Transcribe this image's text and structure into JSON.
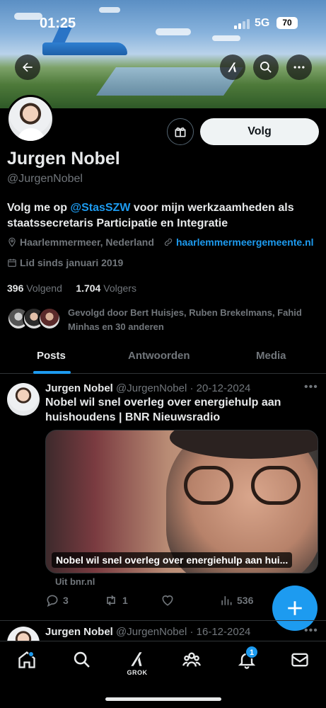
{
  "status_bar": {
    "time": "01:25",
    "network": "5G",
    "battery": "70"
  },
  "profile": {
    "name": "Jurgen Nobel",
    "handle": "@JurgenNobel",
    "follow_label": "Volg",
    "bio_prefix": "Volg me op ",
    "bio_mention": "@StasSZW",
    "bio_suffix": " voor mijn werkzaamheden als staatssecretaris Participatie en Integratie",
    "location": "Haarlemmermeer, Nederland",
    "website": "haarlemmermeergemeente.nl",
    "joined": "Lid sinds januari 2019",
    "following_count": "396",
    "following_label": "Volgend",
    "followers_count": "1.704",
    "followers_label": "Volgers",
    "followed_by": "Gevolgd door Bert Huisjes, Ruben Brekelmans, Fahid Minhas en 30 anderen"
  },
  "tabs": [
    {
      "label": "Posts",
      "active": true
    },
    {
      "label": "Antwoorden",
      "active": false
    },
    {
      "label": "Media",
      "active": false
    }
  ],
  "posts": [
    {
      "author": "Jurgen Nobel",
      "handle": "@JurgenNobel",
      "date": "· 20-12-2024",
      "text": "Nobel wil snel overleg over energiehulp aan huishoudens | BNR Nieuwsradio",
      "card_title": "Nobel wil snel overleg over energiehulp aan hui...",
      "card_source": "Uit bnr.nl",
      "replies": "3",
      "reposts": "1",
      "views": "536"
    },
    {
      "author": "Jurgen Nobel",
      "handle": "@JurgenNobel",
      "date": "· 16-12-2024"
    }
  ],
  "bottom_nav": {
    "grok_label": "GROK",
    "notifications_badge": "1"
  },
  "colors": {
    "accent": "#1d9bf0",
    "background": "#000000",
    "secondary_text": "#71767b"
  }
}
